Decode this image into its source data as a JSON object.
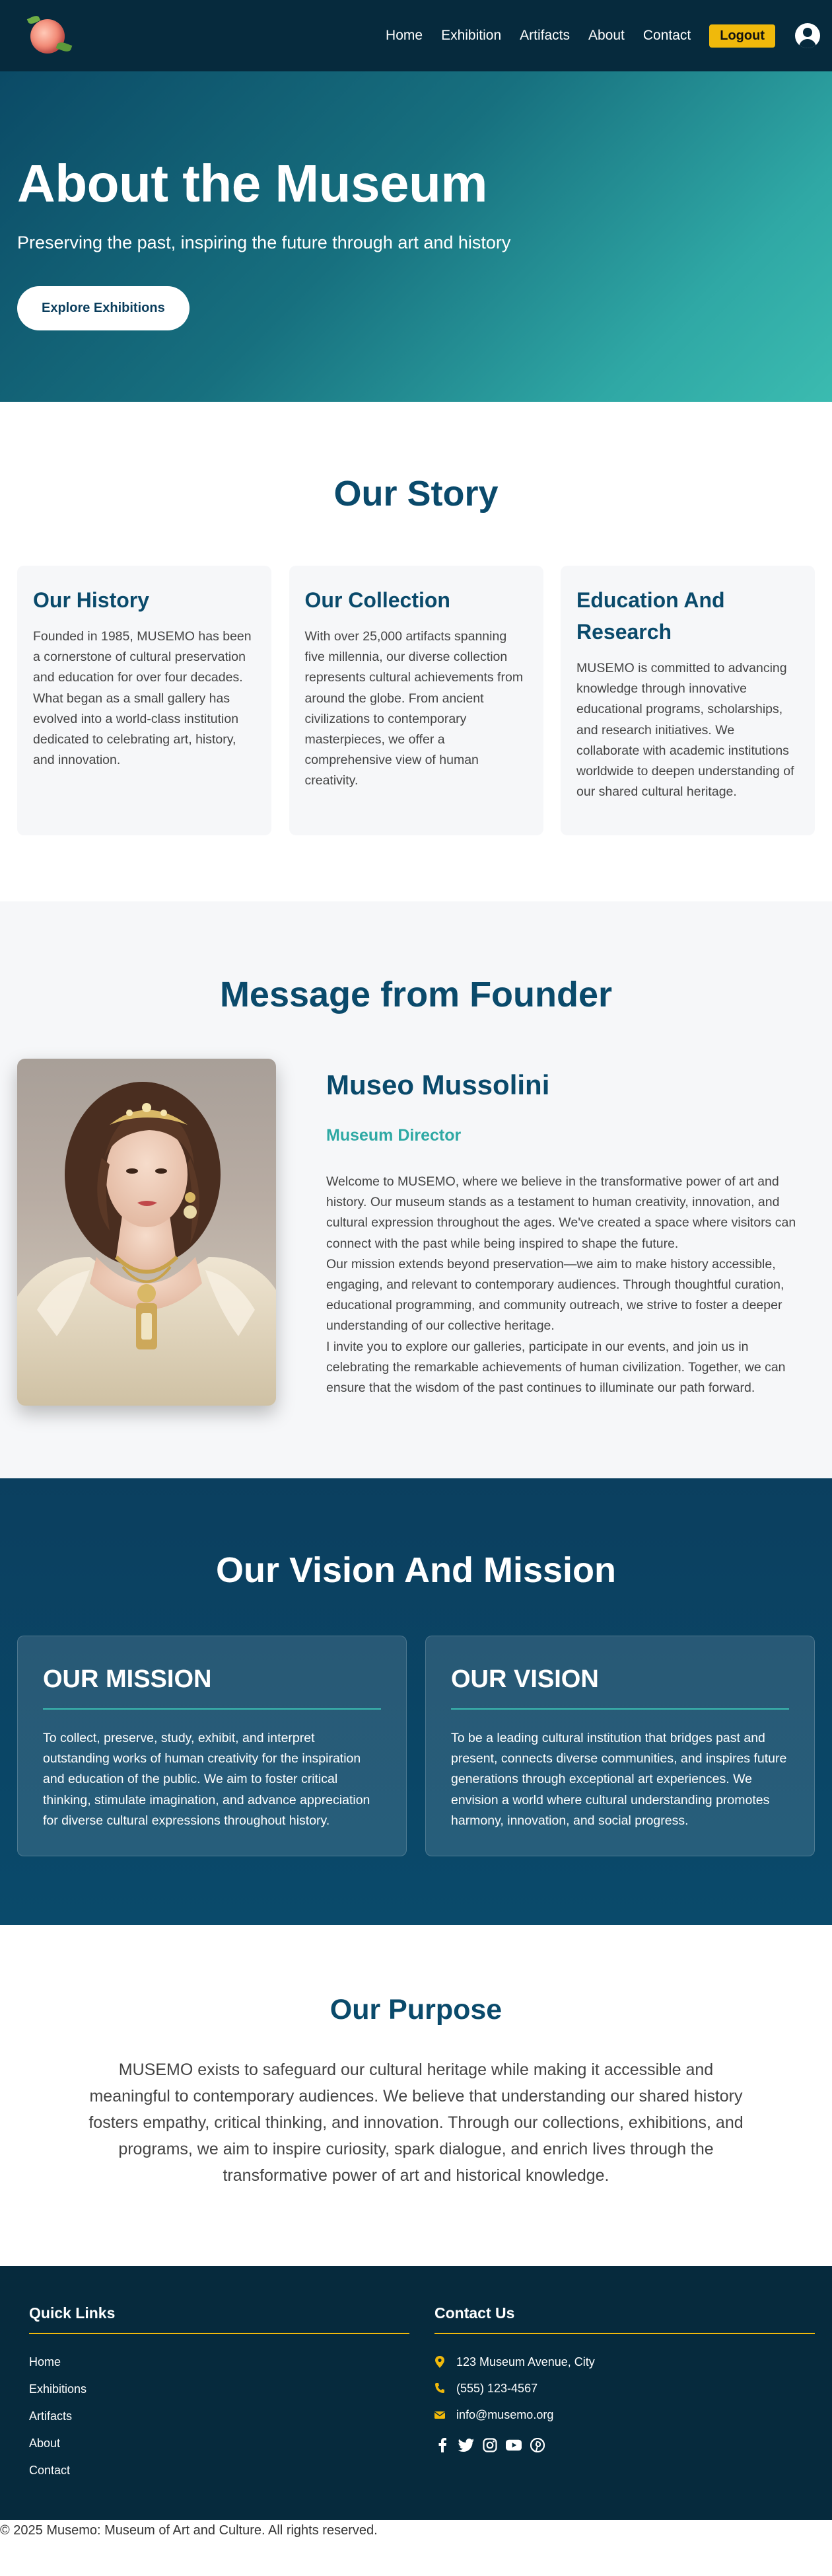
{
  "nav": {
    "links": [
      "Home",
      "Exhibition",
      "Artifacts",
      "About",
      "Contact"
    ],
    "logout_label": "Logout"
  },
  "hero": {
    "title": "About the Museum",
    "subtitle": "Preserving the past, inspiring the future through art and history",
    "button_label": "Explore Exhibitions"
  },
  "story": {
    "title": "Our Story",
    "cards": [
      {
        "title": "Our History",
        "text": "Founded in 1985, MUSEMO has been a cornerstone of cultural preservation and education for over four decades. What began as a small gallery has evolved into a world-class institution dedicated to celebrating art, history, and innovation."
      },
      {
        "title": "Our Collection",
        "text": "With over 25,000 artifacts spanning five millennia, our diverse collection represents cultural achievements from around the globe. From ancient civilizations to contemporary masterpieces, we offer a comprehensive view of human creativity."
      },
      {
        "title": "Education And Research",
        "text": "MUSEMO is committed to advancing knowledge through innovative educational programs, scholarships, and research initiatives. We collaborate with academic institutions worldwide to deepen understanding of our shared cultural heritage."
      }
    ]
  },
  "founder": {
    "section_title": "Message from Founder",
    "name": "Museo Mussolini",
    "role": "Museum Director",
    "paragraphs": [
      "Welcome to MUSEMO, where we believe in the transformative power of art and history. Our museum stands as a testament to human creativity, innovation, and cultural expression throughout the ages. We've created a space where visitors can connect with the past while being inspired to shape the future.",
      "Our mission extends beyond preservation—we aim to make history accessible, engaging, and relevant to contemporary audiences. Through thoughtful curation, educational programming, and community outreach, we strive to foster a deeper understanding of our collective heritage.",
      "I invite you to explore our galleries, participate in our events, and join us in celebrating the remarkable achievements of human civilization. Together, we can ensure that the wisdom of the past continues to illuminate our path forward."
    ]
  },
  "vision": {
    "title": "Our Vision And Mission",
    "cards": [
      {
        "title": "OUR MISSION",
        "text": "To collect, preserve, study, exhibit, and interpret outstanding works of human creativity for the inspiration and education of the public. We aim to foster critical thinking, stimulate imagination, and advance appreciation for diverse cultural expressions throughout history."
      },
      {
        "title": "OUR VISION",
        "text": "To be a leading cultural institution that bridges past and present, connects diverse communities, and inspires future generations through exceptional art experiences. We envision a world where cultural understanding promotes harmony, innovation, and social progress."
      }
    ]
  },
  "purpose": {
    "title": "Our Purpose",
    "text": "MUSEMO exists to safeguard our cultural heritage while making it accessible and meaningful to contemporary audiences. We believe that understanding our shared history fosters empathy, critical thinking, and innovation. Through our collections, exhibitions, and programs, we aim to inspire curiosity, spark dialogue, and enrich lives through the transformative power of art and historical knowledge."
  },
  "footer": {
    "quick_links_title": "Quick Links",
    "quick_links": [
      "Home",
      "Exhibitions",
      "Artifacts",
      "About",
      "Contact"
    ],
    "contact_title": "Contact Us",
    "address": "123 Museum Avenue, City",
    "phone": "(555) 123-4567",
    "email": "info@musemo.org",
    "socials": [
      "facebook-icon",
      "twitter-icon",
      "instagram-icon",
      "youtube-icon",
      "pinterest-icon"
    ],
    "copyright": "© 2025 Musemo: Museum of Art and Culture. All rights reserved."
  },
  "colors": {
    "navy": "#062a3d",
    "heading": "#0a4a6b",
    "teal": "#2ea9a4",
    "gold": "#f0b90b"
  }
}
